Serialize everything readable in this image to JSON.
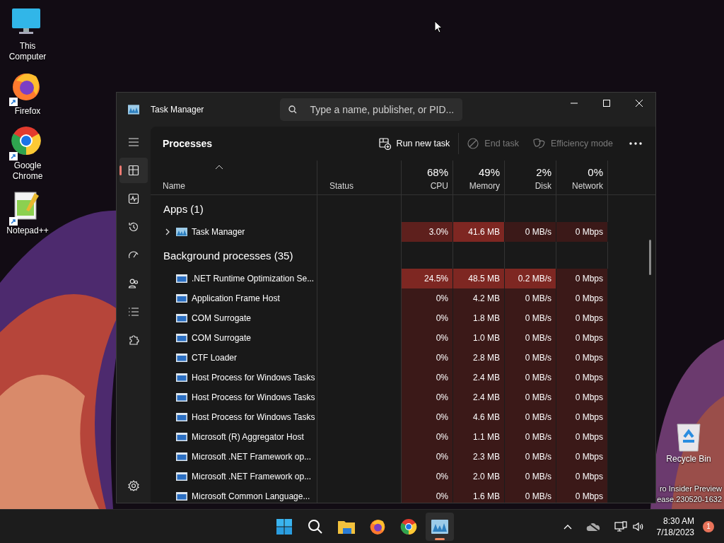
{
  "desktop_icons": [
    {
      "kind": "computer",
      "label": "This Computer",
      "shortcut": false
    },
    {
      "kind": "firefox",
      "label": "Firefox",
      "shortcut": true
    },
    {
      "kind": "chrome",
      "label": "Google Chrome",
      "shortcut": true
    },
    {
      "kind": "notepad",
      "label": "Notepad++",
      "shortcut": true
    }
  ],
  "recycle_bin": {
    "label": "Recycle Bin"
  },
  "desktop_watermark": [
    "ro Insider Preview",
    "ease.230520-1632"
  ],
  "window": {
    "title": "Task Manager",
    "search": {
      "placeholder": "Type a name, publisher, or PID..."
    }
  },
  "nav": [
    {
      "kind": "menu",
      "selected": false
    },
    {
      "kind": "processes",
      "selected": true
    },
    {
      "kind": "performance",
      "selected": false
    },
    {
      "kind": "history",
      "selected": false
    },
    {
      "kind": "startup",
      "selected": false
    },
    {
      "kind": "users",
      "selected": false
    },
    {
      "kind": "details",
      "selected": false
    },
    {
      "kind": "services",
      "selected": false
    }
  ],
  "page": {
    "title": "Processes",
    "actions": [
      {
        "kind": "run",
        "label": "Run new task",
        "disabled": false
      },
      {
        "kind": "end",
        "label": "End task",
        "disabled": true
      },
      {
        "kind": "efficiency",
        "label": "Efficiency mode",
        "disabled": true
      }
    ]
  },
  "table": {
    "columns": [
      {
        "label": "Name"
      },
      {
        "label": "Status"
      },
      {
        "label": "CPU",
        "total": "68%"
      },
      {
        "label": "Memory",
        "total": "49%"
      },
      {
        "label": "Disk",
        "total": "2%"
      },
      {
        "label": "Network",
        "total": "0%"
      }
    ],
    "groups": [
      {
        "title": "Apps (1)",
        "rows": [
          {
            "name": "Task Manager",
            "expanded": false,
            "cells": [
              "3.0%",
              "41.6 MB",
              "0 MB/s",
              "0 Mbps"
            ]
          }
        ]
      },
      {
        "title": "Background processes (35)",
        "rows": [
          {
            "name": ".NET Runtime Optimization Se...",
            "cells": [
              "24.5%",
              "48.5 MB",
              "0.2 MB/s",
              "0 Mbps"
            ]
          },
          {
            "name": "Application Frame Host",
            "cells": [
              "0%",
              "4.2 MB",
              "0 MB/s",
              "0 Mbps"
            ]
          },
          {
            "name": "COM Surrogate",
            "cells": [
              "0%",
              "1.8 MB",
              "0 MB/s",
              "0 Mbps"
            ]
          },
          {
            "name": "COM Surrogate",
            "cells": [
              "0%",
              "1.0 MB",
              "0 MB/s",
              "0 Mbps"
            ]
          },
          {
            "name": "CTF Loader",
            "cells": [
              "0%",
              "2.8 MB",
              "0 MB/s",
              "0 Mbps"
            ]
          },
          {
            "name": "Host Process for Windows Tasks",
            "cells": [
              "0%",
              "2.4 MB",
              "0 MB/s",
              "0 Mbps"
            ]
          },
          {
            "name": "Host Process for Windows Tasks",
            "cells": [
              "0%",
              "2.4 MB",
              "0 MB/s",
              "0 Mbps"
            ]
          },
          {
            "name": "Host Process for Windows Tasks",
            "cells": [
              "0%",
              "4.6 MB",
              "0 MB/s",
              "0 Mbps"
            ]
          },
          {
            "name": "Microsoft (R) Aggregator Host",
            "cells": [
              "0%",
              "1.1 MB",
              "0 MB/s",
              "0 Mbps"
            ]
          },
          {
            "name": "Microsoft .NET Framework op...",
            "cells": [
              "0%",
              "2.3 MB",
              "0 MB/s",
              "0 Mbps"
            ]
          },
          {
            "name": "Microsoft .NET Framework op...",
            "cells": [
              "0%",
              "2.0 MB",
              "0 MB/s",
              "0 Mbps"
            ]
          },
          {
            "name": "Microsoft Common Language...",
            "cells": [
              "0%",
              "1.6 MB",
              "0 MB/s",
              "0 Mbps"
            ]
          }
        ]
      }
    ]
  },
  "taskbar": {
    "apps": [
      {
        "kind": "start",
        "active": false
      },
      {
        "kind": "search",
        "active": false
      },
      {
        "kind": "explorer",
        "active": false
      },
      {
        "kind": "firefox",
        "active": false
      },
      {
        "kind": "chrome",
        "active": false
      },
      {
        "kind": "taskmanager",
        "active": true
      }
    ],
    "time": "8:30 AM",
    "date": "7/18/2023",
    "notifications": "1"
  }
}
